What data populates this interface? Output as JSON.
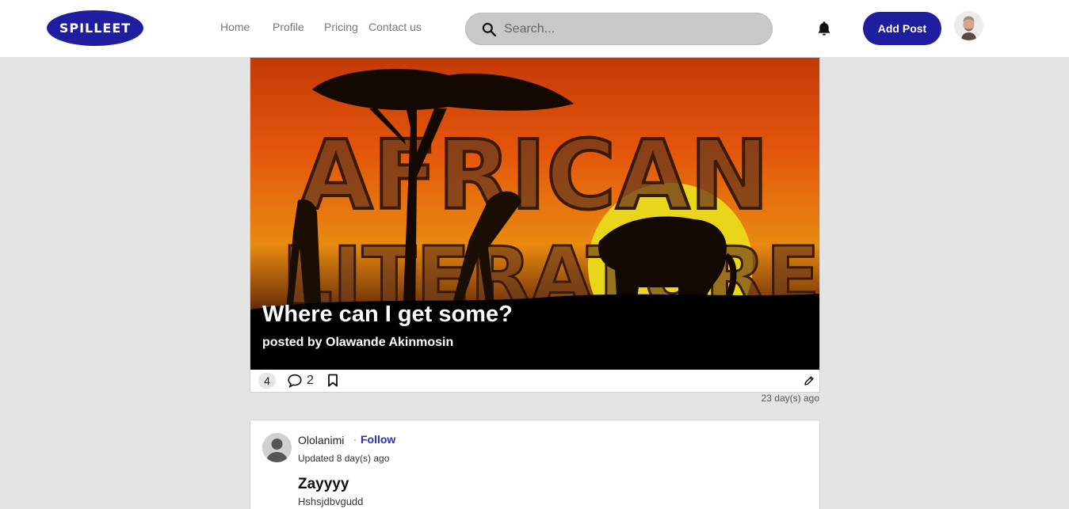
{
  "header": {
    "logo_text": "SPILLEET",
    "nav": [
      "Home",
      "Profile",
      "Pricing",
      "Contact us"
    ],
    "search_placeholder": "Search...",
    "add_post_label": "Add Post",
    "brand_color": "#1f1ea0"
  },
  "featured_post": {
    "image_text_1": "AFRICAN",
    "image_text_2": "LITERATURE",
    "title": "Where can I get some?",
    "author_line": "posted by Olawande Akinmosin",
    "likes": "4",
    "comments": "2",
    "timestamp": "23 day(s) ago"
  },
  "second_post": {
    "author": "Ololanimi",
    "separator": "·",
    "follow_label": "Follow",
    "updated": "Updated 8 day(s) ago",
    "title": "Zayyyy",
    "excerpt": "Hshsjdbvgudd"
  }
}
